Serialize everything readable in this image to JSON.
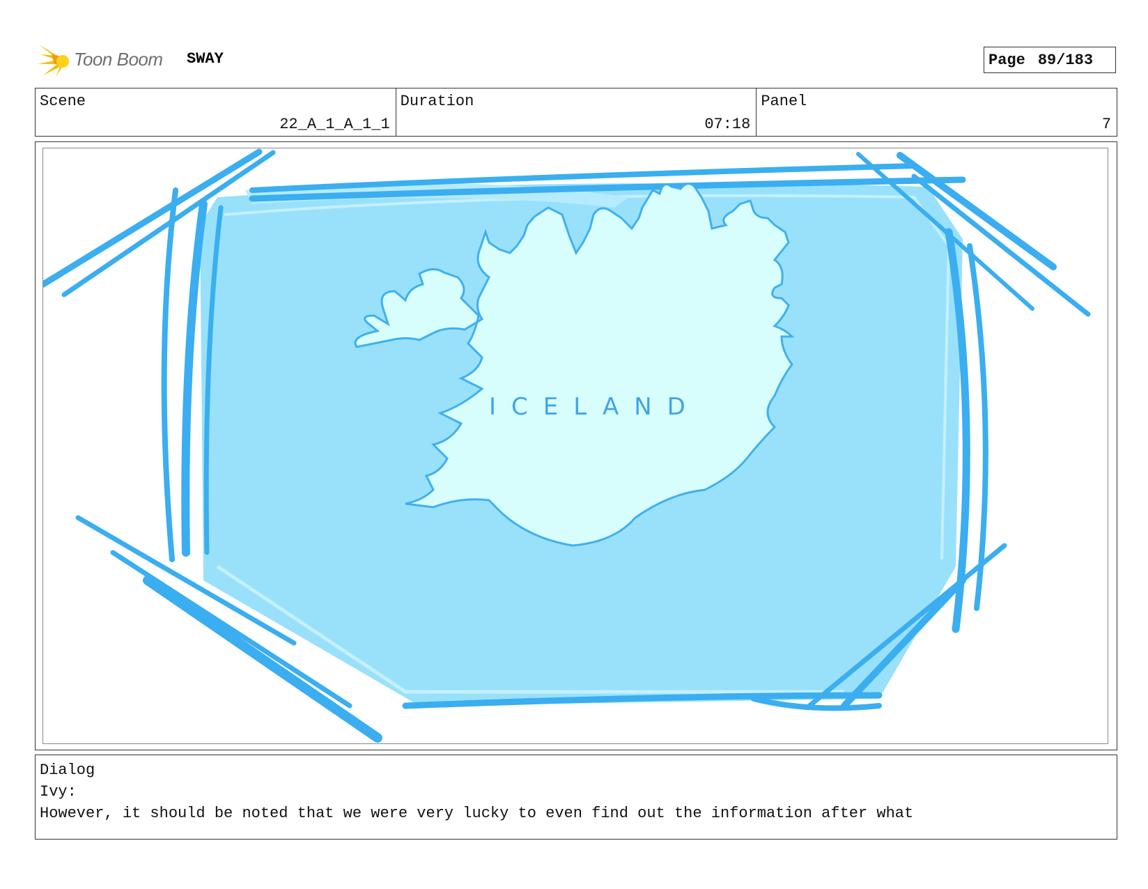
{
  "header": {
    "logo_text": "Toon Boom",
    "project_title": "SWAY",
    "page_label": "Page",
    "page_value": "89/183"
  },
  "info": {
    "scene_label": "Scene",
    "scene_value": "22_A_1_A_1_1",
    "duration_label": "Duration",
    "duration_value": "07:18",
    "panel_label": "Panel",
    "panel_value": "7"
  },
  "panel": {
    "map_label": "ICELAND",
    "colors": {
      "water": "#99e1fb",
      "land": "#d8fdfd",
      "outline": "#3fb0ee",
      "frame_strokes": "#3aaef0"
    }
  },
  "dialog": {
    "label": "Dialog",
    "speaker": "Ivy:",
    "text": "However, it should be noted that we were very lucky to even find out the information after what"
  }
}
